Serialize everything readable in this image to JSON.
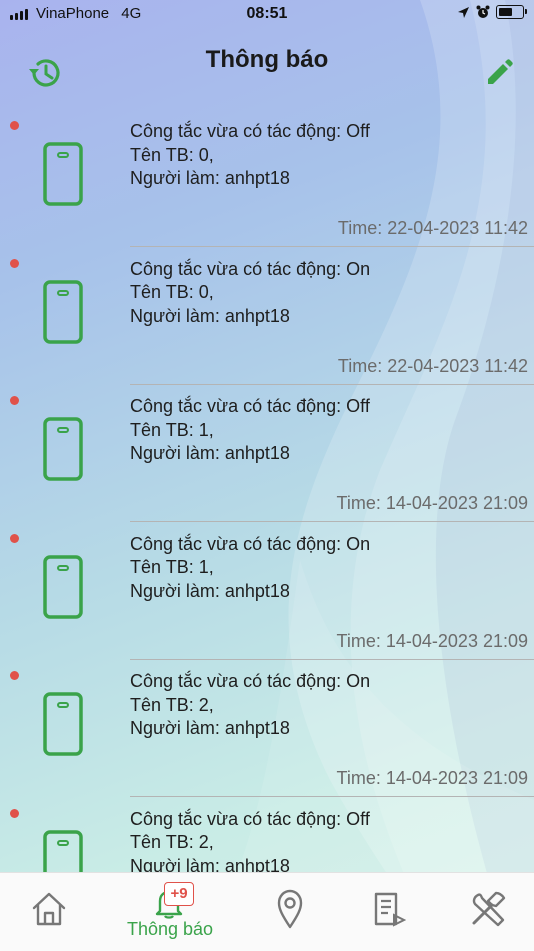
{
  "status_bar": {
    "carrier": "VinaPhone",
    "network": "4G",
    "time": "08:51",
    "icons": [
      "signal-icon",
      "location-arrow-icon",
      "alarm-icon",
      "battery-icon"
    ]
  },
  "header": {
    "title": "Thông báo",
    "left_icon": "history-icon",
    "right_icon": "edit-icon"
  },
  "notifications": [
    {
      "line1": "Công tắc vừa có tác động: Off",
      "line2": "Tên TB: 0,",
      "line3": "Người làm: anhpt18",
      "time": "Time: 22-04-2023 11:42"
    },
    {
      "line1": "Công tắc vừa có tác động: On",
      "line2": "Tên TB: 0,",
      "line3": "Người làm: anhpt18",
      "time": "Time: 22-04-2023 11:42"
    },
    {
      "line1": "Công tắc vừa có tác động: Off",
      "line2": "Tên TB: 1,",
      "line3": "Người làm: anhpt18",
      "time": "Time: 14-04-2023 21:09"
    },
    {
      "line1": "Công tắc vừa có tác động: On",
      "line2": "Tên TB: 1,",
      "line3": "Người làm: anhpt18",
      "time": "Time: 14-04-2023 21:09"
    },
    {
      "line1": "Công tắc vừa có tác động: On",
      "line2": "Tên TB: 2,",
      "line3": "Người làm: anhpt18",
      "time": "Time: 14-04-2023 21:09"
    },
    {
      "line1": "Công tắc vừa có tác động: Off",
      "line2": "Tên TB: 2,",
      "line3": "Người làm: anhpt18",
      "time": ""
    }
  ],
  "bottom_nav": {
    "items": [
      {
        "icon": "home-icon",
        "label": ""
      },
      {
        "icon": "bell-icon",
        "label": "Thông báo",
        "badge": "+9",
        "active": true
      },
      {
        "icon": "location-pin-icon",
        "label": ""
      },
      {
        "icon": "document-icon",
        "label": ""
      },
      {
        "icon": "tools-icon",
        "label": ""
      }
    ]
  },
  "colors": {
    "accent_green": "#3aa34a",
    "unread_dot": "#e0524a",
    "badge_red": "#e0524a"
  }
}
